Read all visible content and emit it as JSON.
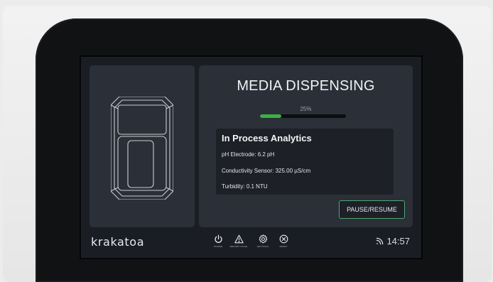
{
  "screen": {
    "title": "MEDIA DISPENSING",
    "progress": {
      "label": "25%",
      "percent": 25
    },
    "analytics": {
      "heading": "In Process Analytics",
      "metrics": [
        "pH Electrode: 6.2 pH",
        "Conductivity Sensor: 325.00 µS/cm",
        "Turbidity: 0.1 NTU"
      ]
    },
    "pause_button": "PAUSE/RESUME"
  },
  "footer": {
    "logo": "krakatoa",
    "nav": [
      {
        "icon": "power-icon",
        "label": "POWER"
      },
      {
        "icon": "warning-icon",
        "label": "REPORT ISSUE"
      },
      {
        "icon": "gear-icon",
        "label": "SETTINGS"
      },
      {
        "icon": "close-circle-icon",
        "label": "ABORT"
      }
    ],
    "status": {
      "icon": "wifi-icon",
      "time": "14:57"
    }
  },
  "colors": {
    "accent_progress": "#3cb043",
    "button_border": "#4fa672",
    "panel": "#2b2f38",
    "screen_bg": "#1b1d24"
  }
}
